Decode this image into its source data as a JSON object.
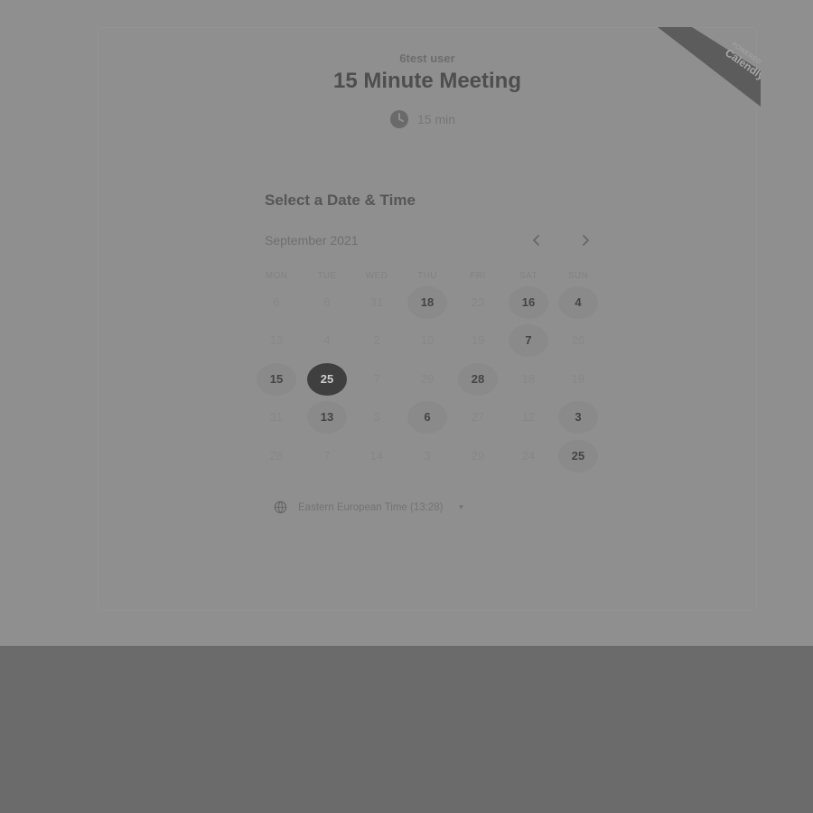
{
  "booking": {
    "owner": "6test user",
    "title": "15 Minute Meeting",
    "duration": "15 min",
    "ribbon_small": "POWERED BY",
    "ribbon_brand": "Calendly"
  },
  "calendar": {
    "heading": "Select a Date & Time",
    "month_label": "September 2021",
    "weekdays": [
      "MON",
      "TUE",
      "WED",
      "THU",
      "FRI",
      "SAT",
      "SUN"
    ],
    "weeks": [
      [
        {
          "label": "6",
          "state": "disabled"
        },
        {
          "label": "8",
          "state": "disabled"
        },
        {
          "label": "31",
          "state": "disabled"
        },
        {
          "label": "18",
          "state": "available"
        },
        {
          "label": "23",
          "state": "disabled"
        },
        {
          "label": "16",
          "state": "available"
        },
        {
          "label": "4",
          "state": "available"
        }
      ],
      [
        {
          "label": "13",
          "state": "disabled"
        },
        {
          "label": "4",
          "state": "disabled"
        },
        {
          "label": "2",
          "state": "disabled"
        },
        {
          "label": "10",
          "state": "disabled"
        },
        {
          "label": "19",
          "state": "disabled"
        },
        {
          "label": "7",
          "state": "available"
        },
        {
          "label": "20",
          "state": "disabled"
        }
      ],
      [
        {
          "label": "15",
          "state": "available"
        },
        {
          "label": "25",
          "state": "selected"
        },
        {
          "label": "7",
          "state": "disabled"
        },
        {
          "label": "29",
          "state": "disabled"
        },
        {
          "label": "28",
          "state": "available"
        },
        {
          "label": "18",
          "state": "disabled"
        },
        {
          "label": "19",
          "state": "disabled"
        }
      ],
      [
        {
          "label": "31",
          "state": "disabled"
        },
        {
          "label": "13",
          "state": "available"
        },
        {
          "label": "3",
          "state": "disabled"
        },
        {
          "label": "6",
          "state": "available"
        },
        {
          "label": "27",
          "state": "disabled"
        },
        {
          "label": "12",
          "state": "disabled"
        },
        {
          "label": "3",
          "state": "available"
        }
      ],
      [
        {
          "label": "28",
          "state": "disabled"
        },
        {
          "label": "7",
          "state": "disabled"
        },
        {
          "label": "14",
          "state": "disabled"
        },
        {
          "label": "3",
          "state": "disabled"
        },
        {
          "label": "29",
          "state": "disabled"
        },
        {
          "label": "24",
          "state": "disabled"
        },
        {
          "label": "25",
          "state": "available"
        }
      ]
    ],
    "prev_icon": "chevron-left-icon",
    "next_icon": "chevron-right-icon"
  },
  "timezone": {
    "label": "Eastern European Time (13:28)",
    "icon": "globe-icon"
  },
  "colors": {
    "overlay": "#6b6b6b",
    "page": "#8f8f8f",
    "selected_day": "#3f3f3f",
    "available_day": "#8a8a8a"
  }
}
